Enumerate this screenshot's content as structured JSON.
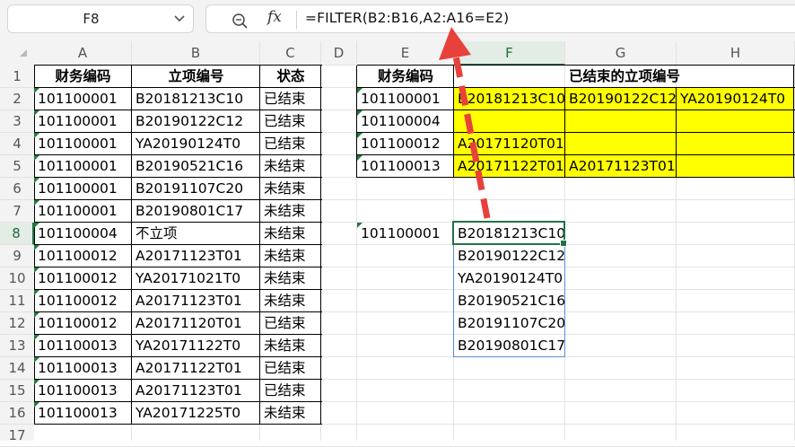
{
  "namebox": {
    "value": "F8",
    "dropdown_icon": "chevron-down-icon"
  },
  "formula_bar": {
    "zoom_icon": "zoom-icon",
    "fx_label": "fx",
    "formula": "=FILTER(B2:B16,A2:A16=E2)"
  },
  "columns": [
    "A",
    "B",
    "C",
    "D",
    "E",
    "F",
    "G",
    "H"
  ],
  "rows": [
    "1",
    "2",
    "3",
    "4",
    "5",
    "6",
    "7",
    "8",
    "9",
    "10",
    "11",
    "12",
    "13",
    "14",
    "15",
    "16",
    "17"
  ],
  "selected_cell": {
    "column": "F",
    "row": "8"
  },
  "table1": {
    "headers": [
      "财务编码",
      "立项编号",
      "状态"
    ],
    "rows": [
      [
        "101100001",
        "B20181213C10",
        "已结束"
      ],
      [
        "101100001",
        "B20190122C12",
        "已结束"
      ],
      [
        "101100001",
        "YA20190124T0",
        "已结束"
      ],
      [
        "101100001",
        "B20190521C16",
        "未结束"
      ],
      [
        "101100001",
        "B20191107C20",
        "未结束"
      ],
      [
        "101100001",
        "B20190801C17",
        "未结束"
      ],
      [
        "101100004",
        "不立项",
        "未结束"
      ],
      [
        "101100012",
        "A20171123T01",
        "未结束"
      ],
      [
        "101100012",
        "YA20171021T0",
        "未结束"
      ],
      [
        "101100012",
        "A20171123T01",
        "未结束"
      ],
      [
        "101100012",
        "A20171120T01",
        "已结束"
      ],
      [
        "101100013",
        "YA20171122T0",
        "未结束"
      ],
      [
        "101100013",
        "A20171122T01",
        "已结束"
      ],
      [
        "101100013",
        "A20171123T01",
        "已结束"
      ],
      [
        "101100013",
        "YA20171225T0",
        "未结束"
      ]
    ]
  },
  "table2": {
    "headers": [
      "财务编码",
      "已结束的立项编号"
    ],
    "rows": [
      [
        "101100001",
        "B20181213C10",
        "B20190122C12",
        "YA20190124T0"
      ],
      [
        "101100004",
        "",
        "",
        ""
      ],
      [
        "101100012",
        "A20171120T01",
        "",
        ""
      ],
      [
        "101100013",
        "A20171122T01",
        "A20171123T01",
        ""
      ]
    ],
    "highlight_color": "#ffff00"
  },
  "filter_demo": {
    "key": "101100001",
    "results": [
      "B20181213C10",
      "B20190122C12",
      "YA20190124T0",
      "B20190521C16",
      "B20191107C20",
      "B20190801C17"
    ]
  },
  "annotation": {
    "color": "#e8413c",
    "points_to": "formula"
  }
}
